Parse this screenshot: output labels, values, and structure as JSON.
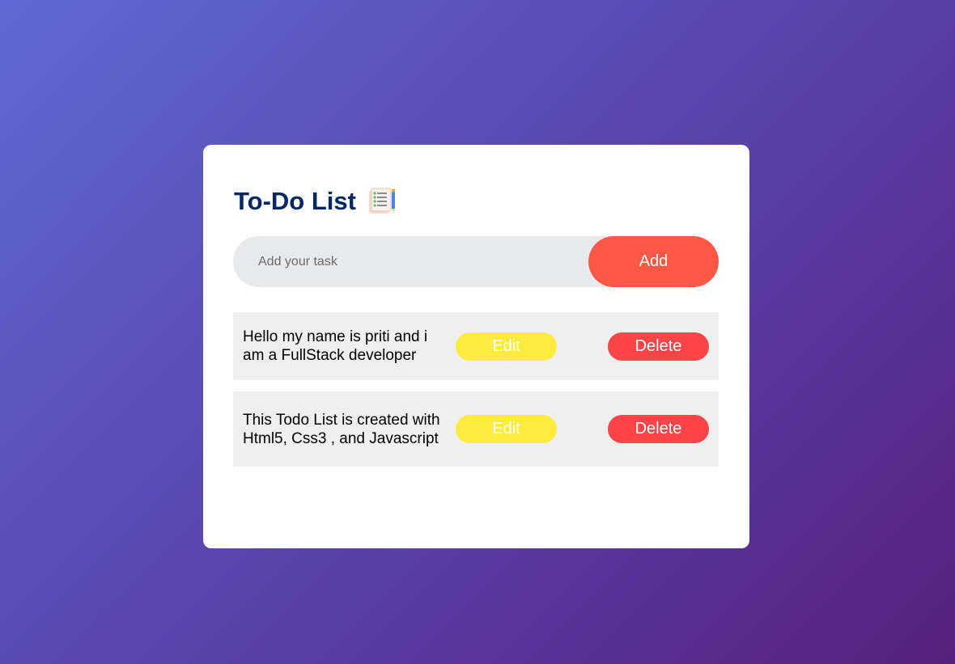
{
  "app": {
    "title": "To-Do List",
    "title_icon": "checklist-notepad-icon"
  },
  "input": {
    "placeholder": "Add your task",
    "value": "",
    "add_label": "Add"
  },
  "tasks": [
    {
      "text": "Hello my name is priti and i am a FullStack developer",
      "edit_label": "Edit",
      "delete_label": "Delete"
    },
    {
      "text": "This Todo List is created with Html5, Css3 , and Javascript",
      "edit_label": "Edit",
      "delete_label": "Delete"
    }
  ],
  "colors": {
    "title": "#002765",
    "add_button": "#ff5945",
    "edit_button": "#fdec3e",
    "delete_button": "#fd4448",
    "input_bg": "#e8e9eb",
    "task_bg": "#efefef"
  }
}
